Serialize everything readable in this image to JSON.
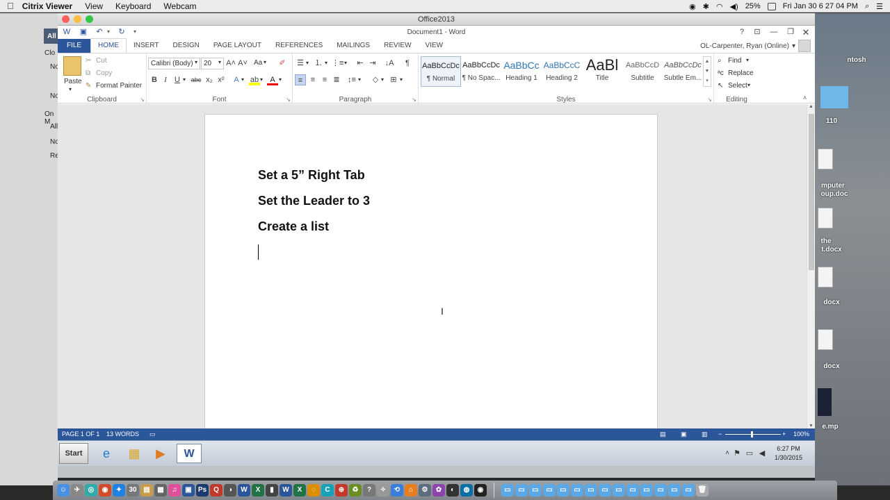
{
  "mac_menu": {
    "app_name": "Citrix Viewer",
    "items": [
      "View",
      "Keyboard",
      "Webcam"
    ],
    "battery": "25%",
    "datetime": "Fri Jan 30  6 27 04 PM"
  },
  "window_title": "Office2013",
  "word": {
    "doc_title": "Document1 - Word",
    "help": "?",
    "tabs": [
      "FILE",
      "HOME",
      "INSERT",
      "DESIGN",
      "PAGE LAYOUT",
      "REFERENCES",
      "MAILINGS",
      "REVIEW",
      "VIEW"
    ],
    "user": "OL-Carpenter, Ryan (Online)"
  },
  "ribbon": {
    "clipboard": {
      "label": "Clipboard",
      "paste": "Paste",
      "cut": "Cut",
      "copy": "Copy",
      "format_painter": "Format Painter"
    },
    "font": {
      "label": "Font",
      "font_name": "Calibri (Body)",
      "font_size": "20",
      "change_case": "Aa"
    },
    "paragraph": {
      "label": "Paragraph"
    },
    "styles": {
      "label": "Styles",
      "items": [
        {
          "preview": "AaBbCcDc",
          "name": "¶ Normal"
        },
        {
          "preview": "AaBbCcDc",
          "name": "¶ No Spac..."
        },
        {
          "preview": "AaBbCc",
          "name": "Heading 1"
        },
        {
          "preview": "AaBbCcC",
          "name": "Heading 2"
        },
        {
          "preview": "AaBl",
          "name": "Title"
        },
        {
          "preview": "AaBbCcD",
          "name": "Subtitle"
        },
        {
          "preview": "AaBbCcDc",
          "name": "Subtle Em..."
        }
      ]
    },
    "editing": {
      "label": "Editing",
      "find": "Find",
      "replace": "Replace",
      "select": "Select"
    }
  },
  "document": {
    "lines": [
      "Set a 5” Right Tab",
      "Set the Leader to 3",
      "Create a list"
    ]
  },
  "status": {
    "page": "PAGE 1 OF 1",
    "words": "13 WORDS",
    "zoom": "100%"
  },
  "taskbar": {
    "start": "Start",
    "time": "6:27 PM",
    "date": "1/30/2015"
  },
  "desktop_left": [
    "All",
    "Clo",
    "No",
    "No",
    "On M",
    "All",
    "No",
    "Re"
  ],
  "desktop_right": [
    "ntosh",
    "110",
    "mputer",
    "oup.doc",
    "the",
    "t.docx",
    "docx",
    "docx",
    "e.mp"
  ],
  "colors": {
    "word_blue": "#2b579a",
    "ribbon_bg": "#ffffff",
    "doc_bg": "#e6e6e6"
  }
}
